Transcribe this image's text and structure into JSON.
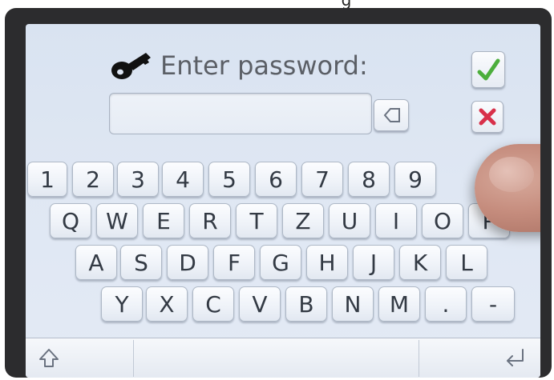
{
  "prompt_text": "Enter password:",
  "password_value": "",
  "keyboard": {
    "row_digits": [
      "1",
      "2",
      "3",
      "4",
      "5",
      "6",
      "7",
      "8",
      "9"
    ],
    "row_top": [
      "Q",
      "W",
      "E",
      "R",
      "T",
      "Z",
      "U",
      "I",
      "O",
      "P"
    ],
    "row_home": [
      "A",
      "S",
      "D",
      "F",
      "G",
      "H",
      "J",
      "K",
      "L"
    ],
    "row_bottom": [
      "Y",
      "X",
      "C",
      "V",
      "B",
      "N",
      "M",
      ".",
      "-"
    ]
  },
  "icons": {
    "key": "key-icon",
    "confirm": "checkmark-icon",
    "cancel": "x-icon",
    "backspace": "backspace-icon",
    "shift": "shift-icon",
    "enter": "enter-icon"
  },
  "colors": {
    "confirm": "#4cae3c",
    "cancel": "#d8304a",
    "screen_bg": "#dde5f2"
  }
}
